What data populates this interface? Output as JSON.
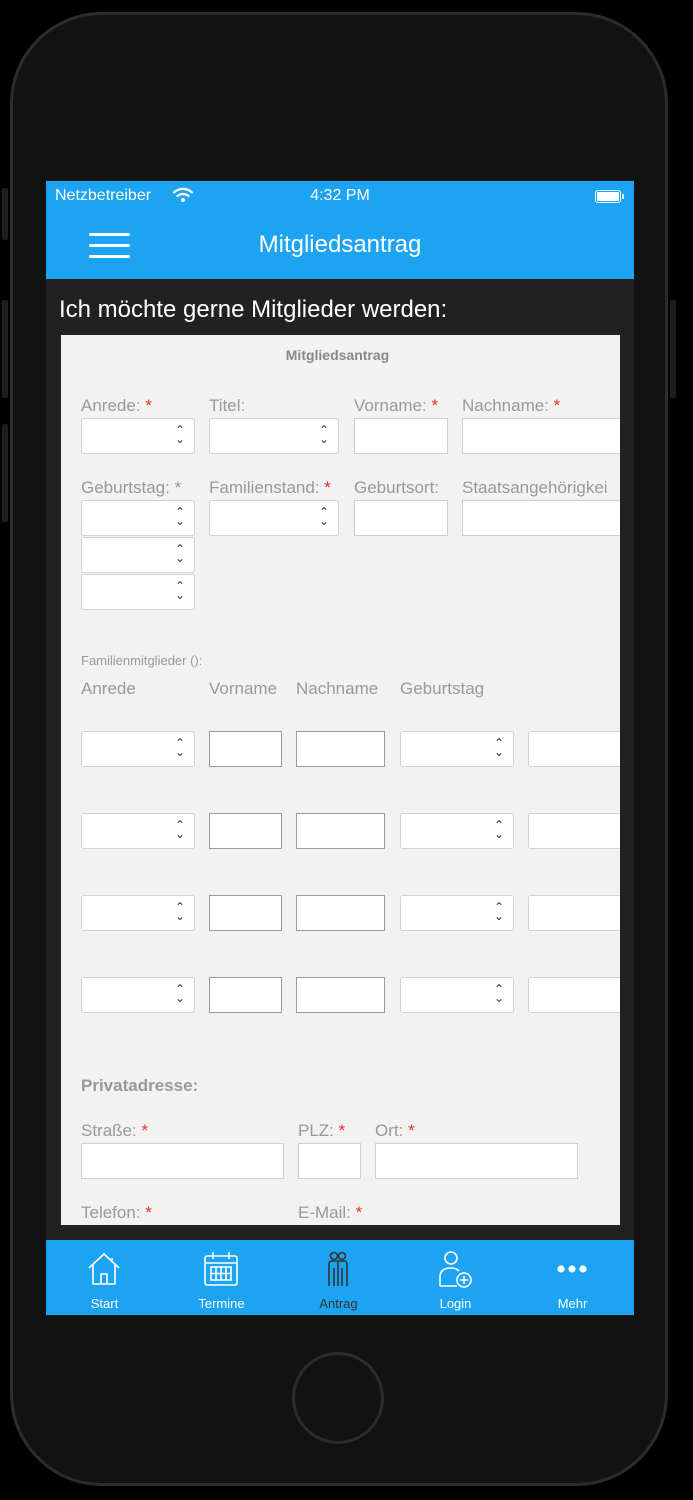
{
  "status_bar": {
    "carrier": "Netzbetreiber",
    "time": "4:32 PM"
  },
  "nav": {
    "title": "Mitgliedsantrag"
  },
  "page": {
    "heading": "Ich möchte gerne Mitglieder werden:"
  },
  "form": {
    "title": "Mitgliedsantrag",
    "required_mark": "*",
    "anrede_label": "Anrede:",
    "titel_label": "Titel:",
    "vorname_label": "Vorname:",
    "nachname_label": "Nachname:",
    "geburtstag_label": "Geburtstag:",
    "familienstand_label": "Familienstand:",
    "geburtsort_label": "Geburtsort:",
    "staatsangehoerigkeit_label": "Staatsangehörigkei",
    "family": {
      "section_label": "Familienmitglieder ():",
      "columns": [
        "Anrede",
        "Vorname",
        "Nachname",
        "Geburtstag"
      ],
      "row_count": 4
    },
    "address": {
      "section_label": "Privatadresse:",
      "strasse_label": "Straße:",
      "plz_label": "PLZ:",
      "ort_label": "Ort:",
      "telefon_label": "Telefon:",
      "email_label": "E-Mail:"
    }
  },
  "tabs": [
    {
      "label": "Start",
      "icon": "home-icon"
    },
    {
      "label": "Termine",
      "icon": "calendar-icon"
    },
    {
      "label": "Antrag",
      "icon": "people-icon"
    },
    {
      "label": "Login",
      "icon": "user-add-icon"
    },
    {
      "label": "Mehr",
      "icon": "more-icon"
    }
  ],
  "colors": {
    "brand": "#1ca4f2",
    "required": "#e3342f",
    "form_bg": "#f2f2f2"
  }
}
